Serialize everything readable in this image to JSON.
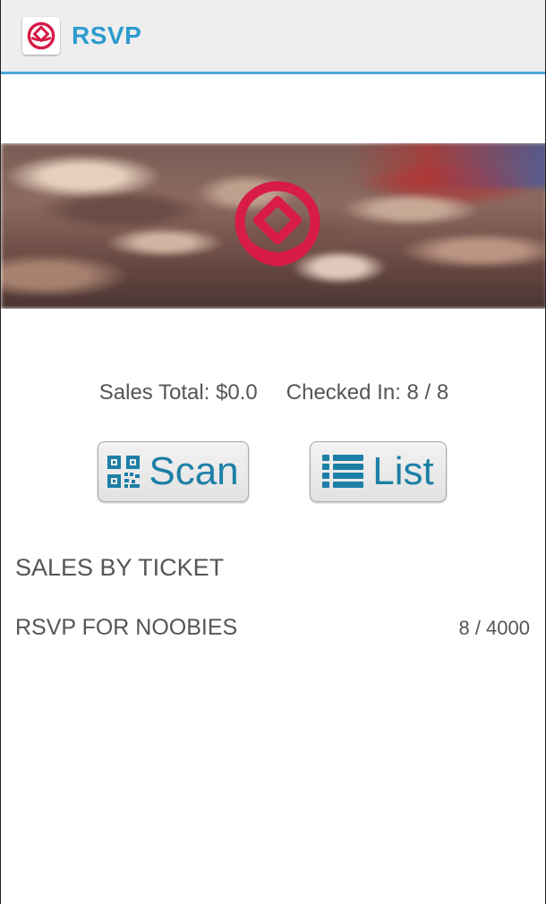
{
  "header": {
    "title": "RSVP",
    "icon": "rsvp-logo-icon",
    "accent_color": "#2d9bd0",
    "border_color": "#4aa8d8"
  },
  "banner": {
    "logo_icon": "rose-logo-icon",
    "logo_color": "#d81b47"
  },
  "stats": {
    "sales_total": "Sales Total: $0.0",
    "checked_in": "Checked In: 8 / 8"
  },
  "actions": {
    "scan_label": "Scan",
    "scan_icon": "qr-code-icon",
    "list_label": "List",
    "list_icon": "list-icon",
    "button_text_color": "#1d7fa6"
  },
  "sales_by_ticket": {
    "title": "SALES BY TICKET",
    "rows": [
      {
        "name": "RSVP FOR NOOBIES",
        "count": "8 / 4000"
      }
    ]
  }
}
